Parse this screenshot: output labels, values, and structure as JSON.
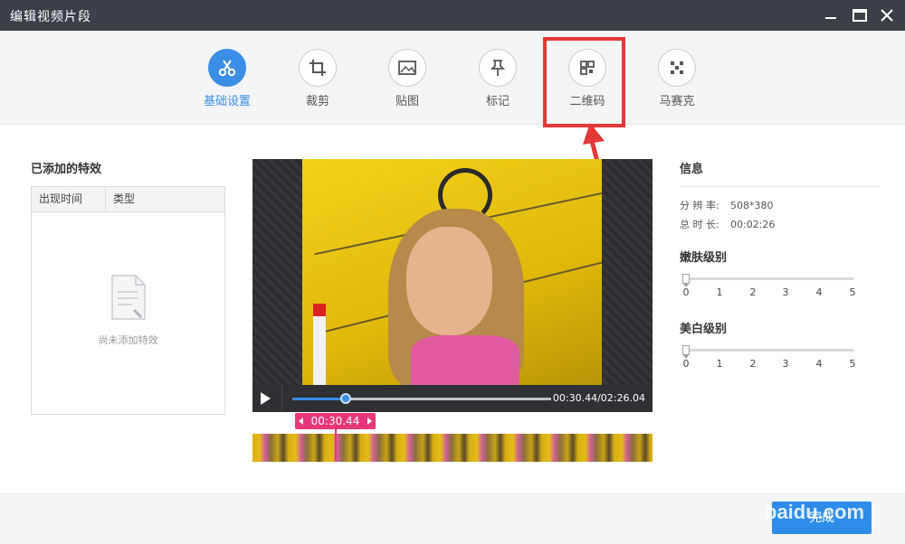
{
  "window": {
    "title": "编辑视频片段",
    "minimize_icon": "minimize-icon",
    "maximize_icon": "maximize-icon",
    "close_icon": "close-icon"
  },
  "toolbar": {
    "items": [
      {
        "label": "基础设置",
        "icon": "scissors-icon",
        "active": true
      },
      {
        "label": "裁剪",
        "icon": "crop-icon",
        "active": false
      },
      {
        "label": "贴图",
        "icon": "image-icon",
        "active": false
      },
      {
        "label": "标记",
        "icon": "pin-icon",
        "active": false
      },
      {
        "label": "二维码",
        "icon": "qrcode-icon",
        "active": false
      },
      {
        "label": "马赛克",
        "icon": "mosaic-icon",
        "active": false
      }
    ],
    "accent_color": "#3a8ee6"
  },
  "effects": {
    "title": "已添加的特效",
    "columns": [
      "出现时间",
      "类型"
    ],
    "empty_text": "尚未添加特效"
  },
  "player": {
    "current_time": "00:30.44",
    "total_time": "02:26.04",
    "time_display": "00:30.44/02:26.04",
    "progress": 0.208,
    "marker_time": "00:30.44"
  },
  "info": {
    "title": "信息",
    "resolution_label": "分 辨 率:",
    "resolution_value": "508*380",
    "duration_label": "总 时 长:",
    "duration_value": "00:02:26"
  },
  "smooth": {
    "title": "嫩肤级别",
    "ticks": [
      "0",
      "1",
      "2",
      "3",
      "4",
      "5"
    ],
    "value": 0
  },
  "whiten": {
    "title": "美白级别",
    "ticks": [
      "0",
      "1",
      "2",
      "3",
      "4",
      "5"
    ],
    "value": 0
  },
  "footer": {
    "done_label": "完成"
  },
  "watermark": "baidu.com",
  "annotation_color": "#e23838"
}
